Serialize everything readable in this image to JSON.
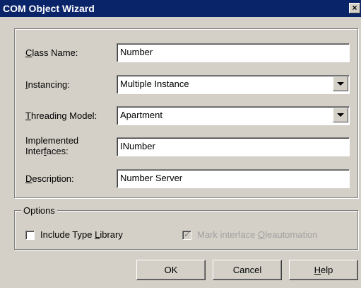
{
  "window": {
    "title": "COM Object Wizard",
    "close_glyph": "×"
  },
  "form": {
    "class_name": {
      "label_pre": "",
      "label_accel": "C",
      "label_post": "lass Name:",
      "value": "Number"
    },
    "instancing": {
      "label_pre": "",
      "label_accel": "I",
      "label_post": "nstancing:",
      "value": "Multiple Instance"
    },
    "threading_model": {
      "label_pre": "",
      "label_accel": "T",
      "label_post": "hreading Model:",
      "value": "Apartment"
    },
    "implemented_interfaces": {
      "label_line1": "Implemented",
      "label_pre": "Inter",
      "label_accel": "f",
      "label_post": "aces:",
      "value": "INumber"
    },
    "description": {
      "label_pre": "",
      "label_accel": "D",
      "label_post": "escription:",
      "value": "Number Server"
    }
  },
  "options": {
    "legend": "Options",
    "include_type_library": {
      "pre": "Include Type ",
      "accel": "L",
      "post": "ibrary",
      "checked": false
    },
    "mark_oleautomation": {
      "pre": "Mark interface ",
      "accel": "O",
      "post": "leautomation",
      "checked": true,
      "enabled": false
    }
  },
  "buttons": {
    "ok": "OK",
    "cancel": "Cancel",
    "help_accel": "H",
    "help_post": "elp"
  },
  "colors": {
    "titlebar": "#0a246a",
    "face": "#d4d0c8"
  }
}
